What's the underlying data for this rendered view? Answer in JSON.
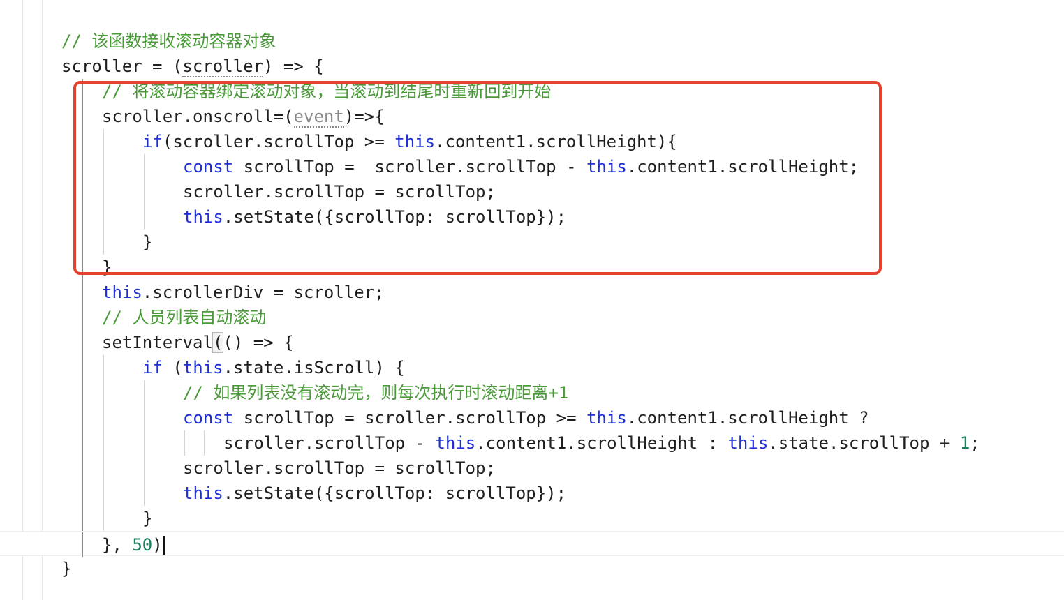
{
  "editor": {
    "lines": [
      {
        "id": "l1",
        "indent": 1,
        "tokens": [
          {
            "t": "// 该函数接收滚动容器对象",
            "c": "cm"
          }
        ]
      },
      {
        "id": "l2",
        "indent": 1,
        "tokens": [
          {
            "t": "scroller = (",
            "c": "tok-plain"
          },
          {
            "t": "scroller",
            "c": "tok-plain"
          },
          {
            "t": ") => {",
            "c": "tok-plain"
          }
        ]
      },
      {
        "id": "l3",
        "indent": 2,
        "tokens": [
          {
            "t": "// 将滚动容器绑定滚动对象，当滚动到结尾时重新回到开始",
            "c": "cm"
          }
        ]
      },
      {
        "id": "l4",
        "indent": 2,
        "tokens": [
          {
            "t": "scroller.onscroll=(",
            "c": "tok-plain"
          },
          {
            "t": "event",
            "c": "param"
          },
          {
            "t": ")=>{",
            "c": "tok-plain"
          }
        ]
      },
      {
        "id": "l5",
        "indent": 3,
        "tokens": [
          {
            "t": "if",
            "c": "kw"
          },
          {
            "t": "(scroller.scrollTop >= ",
            "c": "tok-plain"
          },
          {
            "t": "this",
            "c": "kw"
          },
          {
            "t": ".content1.scrollHeight){",
            "c": "tok-plain"
          }
        ]
      },
      {
        "id": "l6",
        "indent": 4,
        "tokens": [
          {
            "t": "const",
            "c": "kw"
          },
          {
            "t": " scrollTop =  scroller.scrollTop - ",
            "c": "tok-plain"
          },
          {
            "t": "this",
            "c": "kw"
          },
          {
            "t": ".content1.scrollHeight;",
            "c": "tok-plain"
          }
        ]
      },
      {
        "id": "l7",
        "indent": 4,
        "tokens": [
          {
            "t": "scroller.scrollTop = scrollTop;",
            "c": "tok-plain"
          }
        ]
      },
      {
        "id": "l8",
        "indent": 4,
        "tokens": [
          {
            "t": "this",
            "c": "kw"
          },
          {
            "t": ".setState({scrollTop: scrollTop});",
            "c": "tok-plain"
          }
        ]
      },
      {
        "id": "l9",
        "indent": 3,
        "tokens": [
          {
            "t": "}",
            "c": "tok-plain"
          }
        ]
      },
      {
        "id": "l10",
        "indent": 2,
        "tokens": [
          {
            "t": "}",
            "c": "tok-plain"
          }
        ]
      },
      {
        "id": "l11",
        "indent": 2,
        "tokens": [
          {
            "t": "this",
            "c": "kw"
          },
          {
            "t": ".scrollerDiv = scroller;",
            "c": "tok-plain"
          }
        ]
      },
      {
        "id": "l12",
        "indent": 2,
        "tokens": [
          {
            "t": "// 人员列表自动滚动",
            "c": "cm"
          }
        ]
      },
      {
        "id": "l13",
        "indent": 2,
        "tokens": [
          {
            "t": "setInterval",
            "c": "tok-plain"
          },
          {
            "t": "(",
            "c": "tok-plain"
          },
          {
            "t": "() => {",
            "c": "tok-plain"
          }
        ]
      },
      {
        "id": "l14",
        "indent": 3,
        "tokens": [
          {
            "t": "if",
            "c": "kw"
          },
          {
            "t": " (",
            "c": "tok-plain"
          },
          {
            "t": "this",
            "c": "kw"
          },
          {
            "t": ".state.isScroll) {",
            "c": "tok-plain"
          }
        ]
      },
      {
        "id": "l15",
        "indent": 4,
        "tokens": [
          {
            "t": "// 如果列表没有滚动完，则每次执行时滚动距离+1",
            "c": "cm"
          }
        ]
      },
      {
        "id": "l16",
        "indent": 4,
        "tokens": [
          {
            "t": "const",
            "c": "kw"
          },
          {
            "t": " scrollTop = scroller.scrollTop >= ",
            "c": "tok-plain"
          },
          {
            "t": "this",
            "c": "kw"
          },
          {
            "t": ".content1.scrollHeight ?",
            "c": "tok-plain"
          }
        ]
      },
      {
        "id": "l17",
        "indent": 5,
        "tokens": [
          {
            "t": "scroller.scrollTop - ",
            "c": "tok-plain"
          },
          {
            "t": "this",
            "c": "kw"
          },
          {
            "t": ".content1.scrollHeight : ",
            "c": "tok-plain"
          },
          {
            "t": "this",
            "c": "kw"
          },
          {
            "t": ".state.scrollTop + ",
            "c": "tok-plain"
          },
          {
            "t": "1",
            "c": "num"
          },
          {
            "t": ";",
            "c": "tok-plain"
          }
        ]
      },
      {
        "id": "l18",
        "indent": 4,
        "tokens": [
          {
            "t": "scroller.scrollTop = scrollTop;",
            "c": "tok-plain"
          }
        ]
      },
      {
        "id": "l19",
        "indent": 4,
        "tokens": [
          {
            "t": "this",
            "c": "kw"
          },
          {
            "t": ".setState({scrollTop: scrollTop});",
            "c": "tok-plain"
          }
        ]
      },
      {
        "id": "l20",
        "indent": 3,
        "tokens": [
          {
            "t": "}",
            "c": "tok-plain"
          }
        ]
      },
      {
        "id": "l21",
        "indent": 2,
        "tokens": [
          {
            "t": "}, ",
            "c": "tok-plain"
          },
          {
            "t": "50",
            "c": "num"
          },
          {
            "t": ")",
            "c": "tok-plain"
          }
        ]
      },
      {
        "id": "l22",
        "indent": 1,
        "tokens": [
          {
            "t": "}",
            "c": "tok-plain"
          }
        ]
      }
    ],
    "current_line": "l21",
    "annotation_color": "#e5432d"
  }
}
